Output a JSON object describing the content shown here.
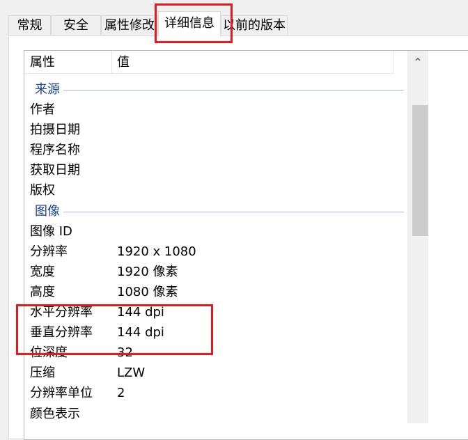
{
  "tabs": [
    {
      "label": "常规"
    },
    {
      "label": "安全"
    },
    {
      "label": "属性修改"
    },
    {
      "label": "详细信息"
    },
    {
      "label": "以前的版本"
    }
  ],
  "header": {
    "property": "属性",
    "value": "值"
  },
  "groups": {
    "source": "来源",
    "image": "图像"
  },
  "source_rows": [
    {
      "name": "作者",
      "value": ""
    },
    {
      "name": "拍摄日期",
      "value": ""
    },
    {
      "name": "程序名称",
      "value": ""
    },
    {
      "name": "获取日期",
      "value": ""
    },
    {
      "name": "版权",
      "value": ""
    }
  ],
  "image_rows": [
    {
      "name": "图像 ID",
      "value": ""
    },
    {
      "name": "分辨率",
      "value": "1920 x 1080"
    },
    {
      "name": "宽度",
      "value": "1920 像素"
    },
    {
      "name": "高度",
      "value": "1080 像素"
    },
    {
      "name": "水平分辨率",
      "value": "144 dpi"
    },
    {
      "name": "垂直分辨率",
      "value": "144 dpi"
    },
    {
      "name": "位深度",
      "value": "32"
    },
    {
      "name": "压缩",
      "value": "LZW"
    },
    {
      "name": "分辨率单位",
      "value": "2"
    },
    {
      "name": "颜色表示",
      "value": ""
    }
  ],
  "highlight_color": "#e8191c",
  "group_color": "#1e3f94",
  "icons": {
    "scroll_up": "chevron-up-icon"
  }
}
